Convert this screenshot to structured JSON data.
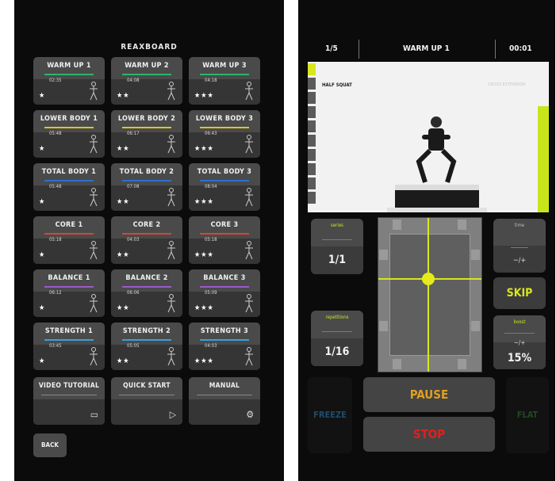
{
  "menu": {
    "logo": "REAXBOARD",
    "tiles": [
      {
        "title": "WARM UP 1",
        "duration": "02:35",
        "stars": "★",
        "bar": "#2fb36a"
      },
      {
        "title": "WARM UP 2",
        "duration": "04:08",
        "stars": "★★",
        "bar": "#2fb36a"
      },
      {
        "title": "WARM UP 3",
        "duration": "04:18",
        "stars": "★★★",
        "bar": "#2fb36a"
      },
      {
        "title": "LOWER BODY 1",
        "duration": "05:48",
        "stars": "★",
        "bar": "#d8c820"
      },
      {
        "title": "LOWER BODY 2",
        "duration": "06:17",
        "stars": "★★",
        "bar": "#d8c820"
      },
      {
        "title": "LOWER BODY 3",
        "duration": "06:43",
        "stars": "★★★",
        "bar": "#d8c820"
      },
      {
        "title": "TOTAL BODY 1",
        "duration": "05:48",
        "stars": "★",
        "bar": "#2e6fd0"
      },
      {
        "title": "TOTAL BODY 2",
        "duration": "07:08",
        "stars": "★★",
        "bar": "#2e6fd0"
      },
      {
        "title": "TOTAL BODY 3",
        "duration": "08:04",
        "stars": "★★★",
        "bar": "#2e6fd0"
      },
      {
        "title": "CORE 1",
        "duration": "05:18",
        "stars": "★",
        "bar": "#d0473c"
      },
      {
        "title": "CORE 2",
        "duration": "04:03",
        "stars": "★★",
        "bar": "#d0473c"
      },
      {
        "title": "CORE 3",
        "duration": "05:18",
        "stars": "★★★",
        "bar": "#d0473c"
      },
      {
        "title": "BALANCE 1",
        "duration": "06:12",
        "stars": "★",
        "bar": "#9b59c8"
      },
      {
        "title": "BALANCE 2",
        "duration": "06:06",
        "stars": "★★",
        "bar": "#9b59c8"
      },
      {
        "title": "BALANCE 3",
        "duration": "05:09",
        "stars": "★★★",
        "bar": "#9b59c8"
      },
      {
        "title": "STRENGTH 1",
        "duration": "03:45",
        "stars": "★",
        "bar": "#3a9fd8"
      },
      {
        "title": "STRENGTH 2",
        "duration": "05:05",
        "stars": "★★",
        "bar": "#3a9fd8"
      },
      {
        "title": "STRENGTH 3",
        "duration": "04:03",
        "stars": "★★★",
        "bar": "#3a9fd8"
      }
    ],
    "utility": [
      {
        "title": "VIDEO TUTORIAL",
        "icon": "▭"
      },
      {
        "title": "QUICK START",
        "icon": "▷"
      },
      {
        "title": "MANUAL",
        "icon": "⚙"
      }
    ],
    "back_label": "BACK"
  },
  "player": {
    "progress": "1/5",
    "workout_title": "WARM UP 1",
    "time": "00:01",
    "exercise_name": "HALF SQUAT",
    "next_exercise": "CROSS EXTENSION",
    "series_label": "series",
    "series_value": "1/1",
    "repetitions_label": "repetitions",
    "repetitions_value": "1/16",
    "time_label": "time",
    "skip_label": "SKIP",
    "boost_label": "boost",
    "boost_value": "15%",
    "freeze_label": "FREEZE",
    "pause_label": "PAUSE",
    "stop_label": "STOP",
    "flat_label": "FLAT",
    "colors": {
      "accent": "#d7e61e",
      "pause": "#e0a020",
      "stop": "#e02020",
      "freeze": "#1e4c6e",
      "flat": "#1f4a20"
    }
  }
}
